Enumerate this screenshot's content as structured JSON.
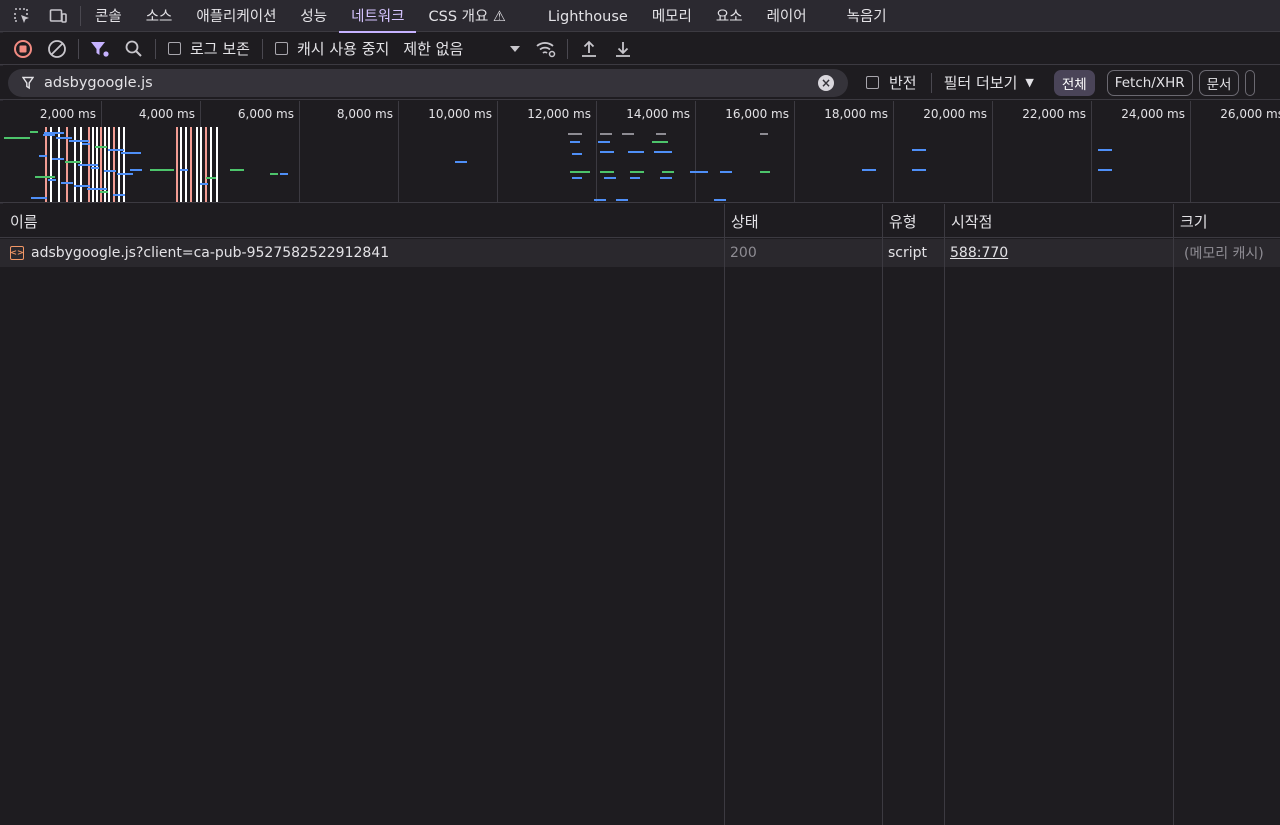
{
  "tabs": [
    {
      "label": "콘솔"
    },
    {
      "label": "소스"
    },
    {
      "label": "애플리케이션"
    },
    {
      "label": "성능"
    },
    {
      "label": "네트워크"
    },
    {
      "label": "CSS 개요 ⚠"
    },
    {
      "label": "Lighthouse"
    },
    {
      "label": "메모리"
    },
    {
      "label": "요소"
    },
    {
      "label": "레이어"
    },
    {
      "label": "녹음기"
    }
  ],
  "active_tab": "네트워크",
  "toolbar": {
    "preserve_log_label": "로그 보존",
    "disable_cache_label": "캐시 사용 중지",
    "throttle_value": "제한 없음"
  },
  "filter": {
    "query": "adsbygoogle.js",
    "invert_label": "반전",
    "more_filters_label": "필터 더보기",
    "chips": [
      {
        "label": "전체",
        "selected": true
      },
      {
        "label": "Fetch/XHR",
        "selected": false
      },
      {
        "label": "문서",
        "selected": false
      }
    ]
  },
  "overview": {
    "ticks": [
      "2,000 ms",
      "4,000 ms",
      "6,000 ms",
      "8,000 ms",
      "10,000 ms",
      "12,000 ms",
      "14,000 ms",
      "16,000 ms",
      "18,000 ms",
      "20,000 ms",
      "22,000 ms",
      "24,000 ms",
      "26,000 ms"
    ],
    "colors": {
      "blue": "#4f8ff7",
      "green": "#4dc46b",
      "grey": "#8e8c93",
      "red": "#f29c93",
      "white": "#ffffff"
    }
  },
  "table": {
    "headers": {
      "name": "이름",
      "status": "상태",
      "type": "유형",
      "initiator": "시작점",
      "size": "크기"
    },
    "rows": [
      {
        "name": "adsbygoogle.js?client=ca-pub-9527582522912841",
        "status": "200",
        "type": "script",
        "initiator": "588:770",
        "size": "(메모리 캐시)"
      }
    ]
  }
}
